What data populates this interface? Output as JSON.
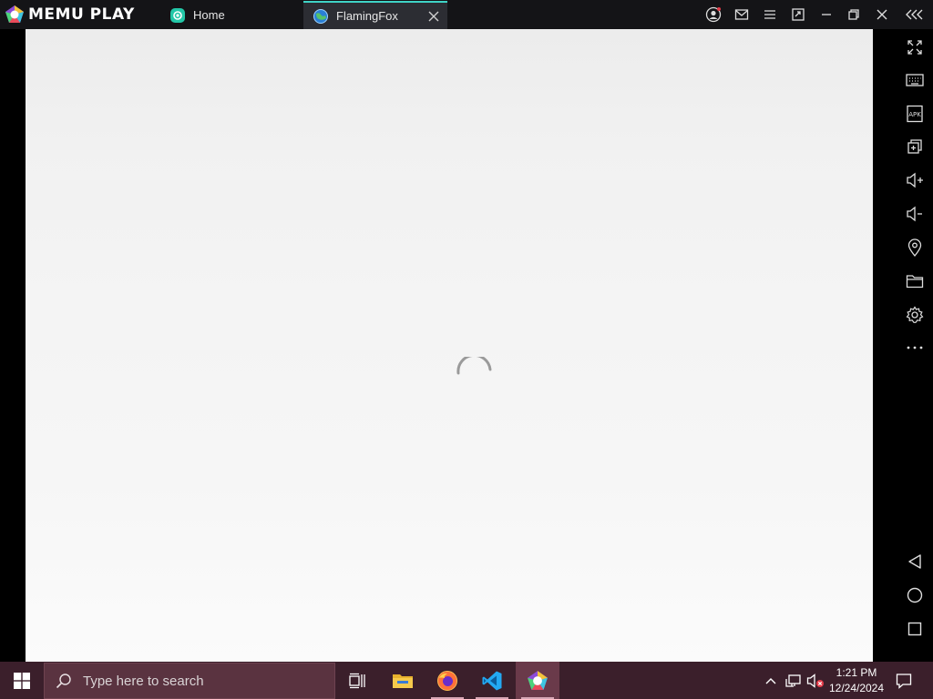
{
  "app": {
    "brand": "MEMU PLAY"
  },
  "tabs": [
    {
      "label": "Home",
      "icon": "home-app-icon"
    },
    {
      "label": "FlamingFox",
      "icon": "flamingfox-globe-icon",
      "active": true
    }
  ],
  "colors": {
    "titlebar": "#141417",
    "active_tab_accent": "#3fd3c6",
    "taskbar": "#3b1f2b",
    "screen_top": "#ececec",
    "screen_bottom": "#fbfbfb"
  },
  "screen": {
    "state": "loading",
    "spinner_icon": "loading-spinner-icon"
  },
  "sidebar": {
    "top_tools": [
      "fullscreen-icon",
      "keyboard-mapping-icon",
      "apk-install-icon",
      "multi-instance-icon",
      "volume-up-icon",
      "volume-down-icon",
      "location-icon",
      "folder-icon",
      "settings-icon",
      "more-icon"
    ],
    "nav": [
      "back-icon",
      "home-circle-icon",
      "recents-icon"
    ]
  },
  "taskbar": {
    "search_placeholder": "Type here to search",
    "time": "1:21 PM",
    "date": "12/24/2024",
    "pinned": [
      "task-view-icon",
      "file-explorer-icon",
      "firefox-icon",
      "vscode-icon",
      "memu-icon"
    ]
  }
}
